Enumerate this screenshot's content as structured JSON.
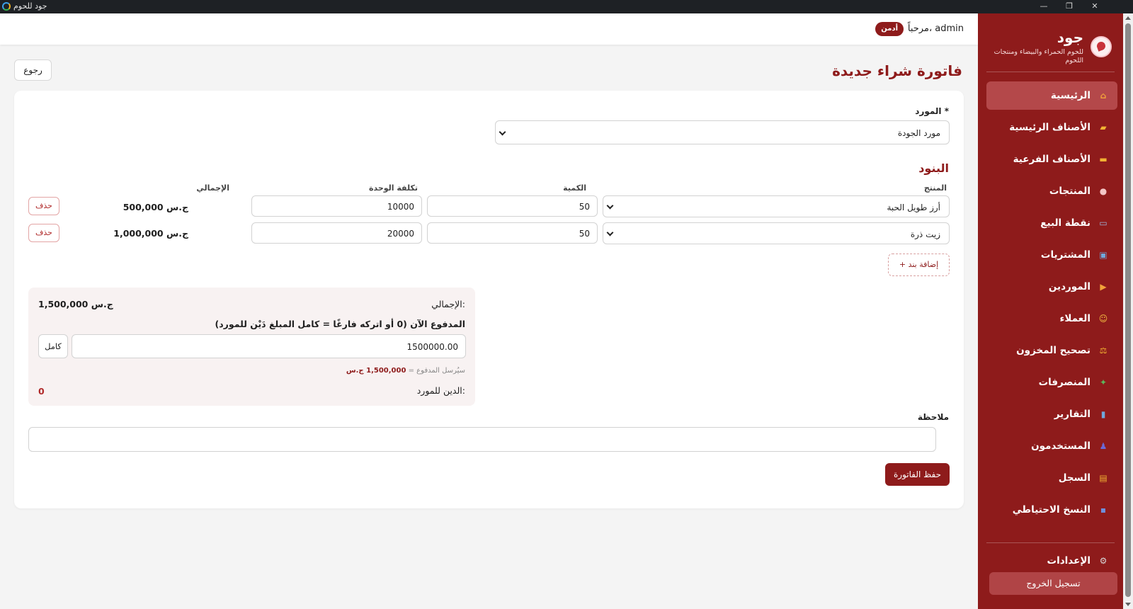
{
  "window": {
    "title": "جود للحوم"
  },
  "brand": {
    "name": "جود",
    "tagline": "للحوم الحمراء والبيضاء ومنتجات اللحوم"
  },
  "nav": {
    "items": [
      {
        "label": "الرئيسية",
        "icon": "home-icon",
        "active": true
      },
      {
        "label": "الأصناف الرئيسية",
        "icon": "folder-open-icon"
      },
      {
        "label": "الأصناف الفرعية",
        "icon": "folder-icon"
      },
      {
        "label": "المنتجات",
        "icon": "meat-icon"
      },
      {
        "label": "نقطة البيع",
        "icon": "cart-icon"
      },
      {
        "label": "المشتريات",
        "icon": "shopping-bag-icon"
      },
      {
        "label": "الموردين",
        "icon": "truck-icon"
      },
      {
        "label": "العملاء",
        "icon": "customer-icon"
      },
      {
        "label": "تصحيح المخزون",
        "icon": "scale-icon"
      },
      {
        "label": "المنصرفات",
        "icon": "money-icon"
      },
      {
        "label": "التقارير",
        "icon": "chart-icon"
      },
      {
        "label": "المستخدمون",
        "icon": "users-icon"
      },
      {
        "label": "السجل",
        "icon": "scroll-icon"
      },
      {
        "label": "النسخ الاحتياطي",
        "icon": "floppy-icon"
      }
    ],
    "settings_label": "الإعدادات",
    "logout_label": "تسجيل الخروج"
  },
  "header": {
    "welcome": "مرحباً، admin",
    "role": "أدمن"
  },
  "page": {
    "title": "فاتورة شراء جديدة",
    "back_label": "رجوع",
    "supplier_label": "المورد *",
    "supplier_value": "مورد الجودة",
    "items_title": "البنود",
    "columns": {
      "product": "المنتج",
      "quantity": "الكمية",
      "unit_cost": "تكلفة الوحدة",
      "total": "الإجمالي"
    },
    "rows": [
      {
        "product": "أرز طويل الحبة",
        "quantity": "50",
        "unit_cost": "10000",
        "total": "500,000 ج.س",
        "delete_label": "حذف"
      },
      {
        "product": "زيت ذرة",
        "quantity": "50",
        "unit_cost": "20000",
        "total": "1,000,000 ج.س",
        "delete_label": "حذف"
      }
    ],
    "add_item_label": "+ إضافة بند",
    "summary": {
      "total_label": "الإجمالي:",
      "total_value": "1,500,000 ج.س",
      "paid_label": "المدفوع الآن (0 أو اتركه فارغًا = كامل المبلغ دَيْن للمورد)",
      "paid_value": "1500000.00",
      "full_label": "كامل",
      "hint_prefix": "سيُرسل المدفوع =",
      "hint_value": "1,500,000 ج.س",
      "debt_label": "الدين للمورد:",
      "debt_value": "0"
    },
    "note_label": "ملاحظة",
    "save_label": "حفظ الفاتورة"
  },
  "colors": {
    "brand": "#8e1b1b",
    "sidebar_active": "#b4484a"
  }
}
